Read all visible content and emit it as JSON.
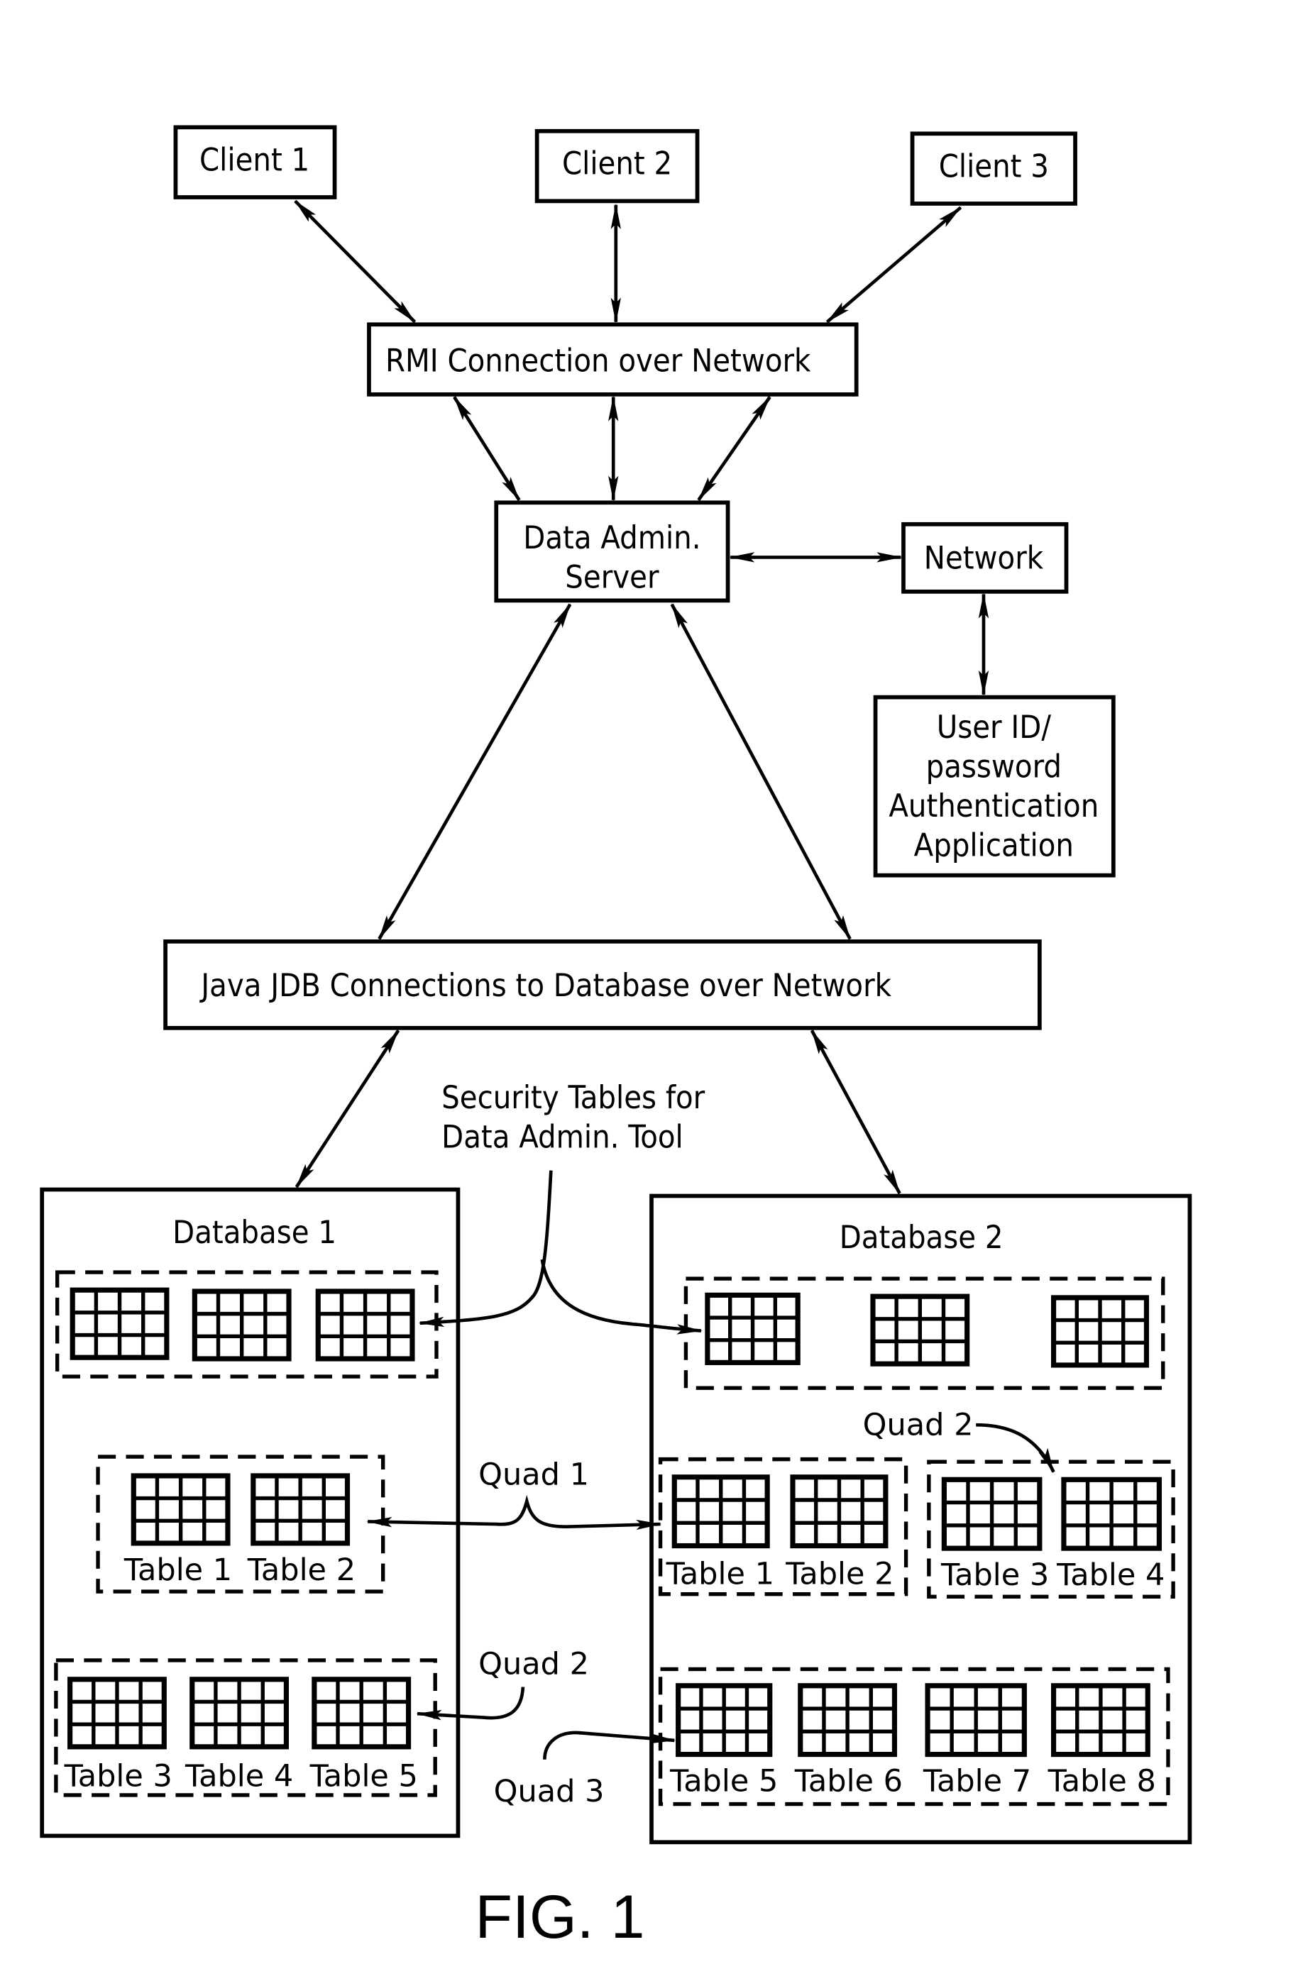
{
  "figure": {
    "caption": "FIG. 1",
    "clients": [
      {
        "label": "Client  1"
      },
      {
        "label": "Client  2"
      },
      {
        "label": "Client  3"
      }
    ],
    "rmi": {
      "label": "RMI  Connection  over  Network"
    },
    "server": {
      "line1": "Data  Admin.",
      "line2": "Server"
    },
    "network": {
      "label": "Network"
    },
    "auth": {
      "lines": [
        "User  ID/",
        "password",
        "Authentication",
        "Application"
      ]
    },
    "jdb": {
      "label": "Java  JDB  Connections  to  Database  over  Network"
    },
    "security_note": {
      "line1": "Security  Tables  for",
      "line2": "Data  Admin.  Tool"
    },
    "database1": {
      "title": "Database  1",
      "groups": [
        {
          "role": "security-tables",
          "tables": [
            "",
            "",
            ""
          ]
        },
        {
          "role": "quad-1",
          "tables": [
            "Table 1",
            "Table 2"
          ]
        },
        {
          "role": "quad-2",
          "tables": [
            "Table 3",
            "Table 4",
            "Table 5"
          ]
        }
      ]
    },
    "database2": {
      "title": "Database  2",
      "groups": [
        {
          "role": "security-tables",
          "tables": [
            "",
            "",
            ""
          ]
        },
        {
          "role": "quad-1",
          "tables": [
            "Table 1",
            "Table 2"
          ]
        },
        {
          "role": "quad-2",
          "tables": [
            "Table 3",
            "Table 4"
          ]
        },
        {
          "role": "quad-3",
          "tables": [
            "Table 5",
            "Table 6",
            "Table 7",
            "Table 8"
          ]
        }
      ]
    },
    "quad_labels": {
      "quad1": "Quad 1",
      "quad2_left": "Quad 2",
      "quad2_right": "Quad 2",
      "quad3": "Quad 3"
    },
    "table_grid": {
      "columns": 4,
      "rows": 3
    }
  }
}
